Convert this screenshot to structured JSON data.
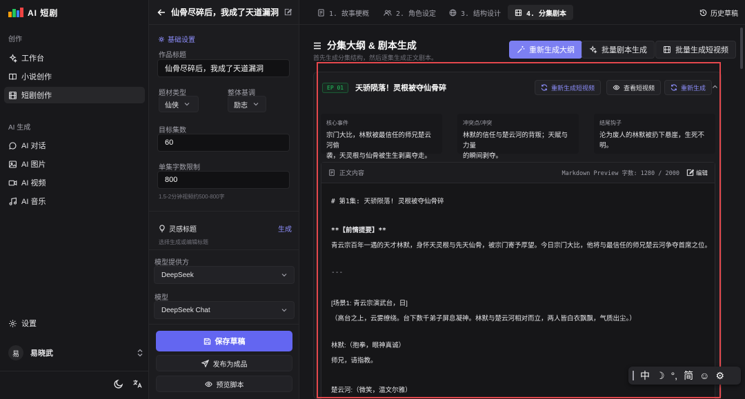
{
  "app": {
    "logo_text": "AI 短剧"
  },
  "sidebar": {
    "section_create": "创作",
    "create_items": [
      {
        "label": "工作台",
        "icon": "sparkles-icon"
      },
      {
        "label": "小说创作",
        "icon": "book-icon"
      },
      {
        "label": "短剧创作",
        "icon": "film-icon",
        "active": true
      }
    ],
    "section_ai": "AI 生成",
    "ai_items": [
      {
        "label": "AI 对话",
        "icon": "chat-icon"
      },
      {
        "label": "AI 图片",
        "icon": "image-icon"
      },
      {
        "label": "AI 视频",
        "icon": "video-icon"
      },
      {
        "label": "AI 音乐",
        "icon": "music-icon"
      }
    ],
    "settings": "设置",
    "user": {
      "avatar": "易",
      "name": "易晓武"
    }
  },
  "form": {
    "title": "仙骨尽碎后，我成了天道漏洞",
    "basic_settings": "基础设置",
    "work_title_label": "作品标题",
    "work_title_value": "仙骨尽碎后，我成了天道漏洞",
    "genre_label": "题材类型",
    "genre_value": "仙侠",
    "tone_label": "整体基调",
    "tone_value": "励志",
    "episodes_label": "目标集数",
    "episodes_value": "60",
    "words_label": "单集字数限制",
    "words_value": "800",
    "words_hint": "1.5-2分钟视频约500-800字",
    "inspiration_label": "灵感标题",
    "inspiration_action": "生成",
    "inspiration_hint": "选择生成或编辑标题",
    "provider_label": "模型提供方",
    "provider_value": "DeepSeek",
    "model_label": "模型",
    "model_value": "DeepSeek Chat",
    "save_button": "保存草稿",
    "publish_button": "发布为成品",
    "preview_button": "预览脚本"
  },
  "tabs": [
    {
      "label": "1. 故事梗概",
      "icon": "doc-icon"
    },
    {
      "label": "2. 角色设定",
      "icon": "users-icon"
    },
    {
      "label": "3. 结构设计",
      "icon": "globe-icon"
    },
    {
      "label": "4. 分集剧本",
      "icon": "film-icon",
      "active": true
    }
  ],
  "history_button": "历史草稿",
  "main": {
    "title": "分集大纲 & 剧本生成",
    "subtitle": "首先生成分集结构，然后逐集生成正文剧本。",
    "regen_outline": "重新生成大纲",
    "batch_script": "批量剧本生成",
    "batch_video": "批量生成短视频"
  },
  "episode": {
    "badge": "EP 01",
    "title": "天骄陨落！灵根被夺仙骨碎",
    "regen_video": "重新生成短视频",
    "view_video": "查看短视频",
    "regen": "重新生成",
    "core_event_label": "核心事件",
    "core_event": [
      "宗门大比，林默被最信任的师兄楚云河偷",
      "袭，天灵根与仙骨被生生剥离夺走。"
    ],
    "conflict_label": "冲突点/冲突",
    "conflict": [
      "林默的信任与楚云河的背叛；天赋与力量",
      "的瞬间剥夺。"
    ],
    "hook_label": "结尾钩子",
    "hook": [
      "沦为废人的林默被扔下悬崖，生死不明。"
    ],
    "content_label": "正文内容",
    "preview_info": "Markdown Preview  字数: 1280 / 2000",
    "edit": "编辑",
    "body": [
      "# 第1集: 天骄陨落! 灵根被夺仙骨碎",
      "**【前情提要】**",
      "青云宗百年一遇的天才林默，身怀天灵根与先天仙骨，被宗门寄予厚望。今日宗门大比，他将与最信任的师兄楚云河争夺首席之位。",
      "---",
      "[场景1: 青云宗演武台，日]",
      "（高台之上，云雾缭绕。台下数千弟子屏息凝神。林默与楚云河相对而立，两人皆白衣飘飘，气质出尘。）",
      "林默:（抱拳，眼神真诚）",
      "师兄，请指教。",
      "楚云河:（微笑，温文尔雅）"
    ]
  },
  "ime": {
    "items": [
      "中",
      "☽",
      "°,",
      "简",
      "☺",
      "⚙"
    ]
  },
  "colors": {
    "accent": "#6366f1",
    "highlight_box": "#e5484d",
    "ep_badge": "#22c55e"
  }
}
